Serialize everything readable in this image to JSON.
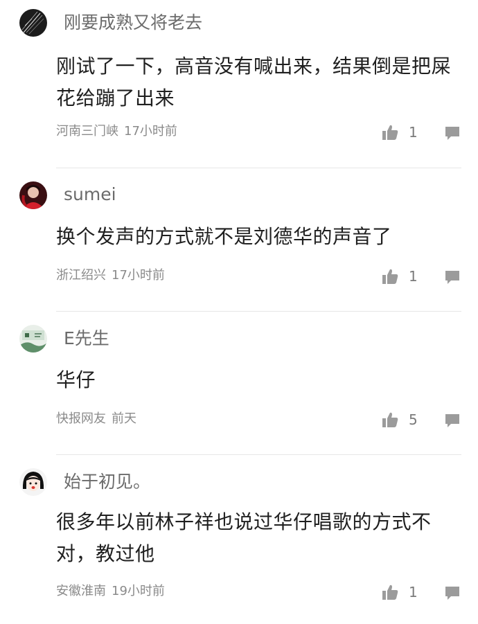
{
  "comments": [
    {
      "username": "刚要成熟又将老去",
      "avatar_icon": "dark-feather-avatar",
      "text": "刚试了一下，高音没有喊出来，结果倒是把屎花给蹦了出来",
      "location": "河南三门峡",
      "time": "17小时前",
      "likes": "1"
    },
    {
      "username": "sumei",
      "avatar_icon": "red-portrait-avatar",
      "text": "换个发声的方式就不是刘德华的声音了",
      "location": "浙江绍兴",
      "time": "17小时前",
      "likes": "1"
    },
    {
      "username": "E先生",
      "avatar_icon": "landscape-avatar",
      "text": "华仔",
      "location": "快报网友",
      "time": "前天",
      "likes": "5"
    },
    {
      "username": "始于初见。",
      "avatar_icon": "cartoon-girl-avatar",
      "text": "很多年以前林子祥也说过华仔唱歌的方式不对，教过他",
      "location": "安徽淮南",
      "time": "19小时前",
      "likes": "1"
    }
  ],
  "icons": {
    "like": "thumbs-up-icon",
    "reply": "speech-bubble-icon"
  },
  "colors": {
    "icon_gray": "#9b9b9b",
    "meta_text": "#8a8a8a",
    "username_text": "#6b6b6b",
    "divider": "#e6e6e6"
  }
}
